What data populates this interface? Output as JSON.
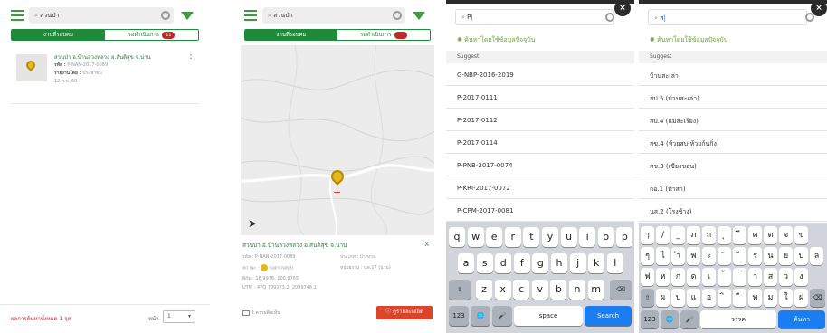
{
  "screens": {
    "list": {
      "search_value": "สวนป่า",
      "tab_map": "งานที่รอบคม",
      "tab_pending": "รอดำเนินการ",
      "pending_count": "11",
      "item": {
        "title": "สวนป่า อ.บ้านลวงหลวง อ.สันติสุข จ.น่าน",
        "code_label": "รหัส :",
        "code_value": "P-NAN-2017-0089",
        "name_label": "รายงานโดย :",
        "name_value": "ประชาชน",
        "meta": "12 ก.พ. 60"
      },
      "footer_left": "ผลการค้นหาทั้งหมด 1 จุด",
      "footer_page_label": "หน้า",
      "footer_page_value": "1"
    },
    "map": {
      "search_value": "สวนป่า",
      "tab_map": "งานที่รอบคม",
      "tab_pending": "รอดำเนินการ",
      "card": {
        "title": "สวนป่า อ.บ้านลวงหลวง อ.สันติสุข จ.น่าน",
        "close": "X",
        "row1_left": "รหัส : P-NAN-2017-0089",
        "row1_right": "ประเภท : ป่าสงวน",
        "row2_left": "สถานะ :",
        "row2_status": "รอตรวจสอบ",
        "row2_right": "หน่วยงาน : นพ.17 (น่าน)",
        "row3_left": "พิกัด : 18.9978, 100.9765",
        "row4_left": "UTM : 47Q 709273.2, 2099746.1",
        "link_left": "2 ความคิดเห็น",
        "detail_btn": "ดูรายละเอียด"
      }
    },
    "suggest_latin": {
      "search_value": "P",
      "hint": "ค้นหาโดยใช้ข้อมูลปัจจุบัน",
      "suggest_label": "Suggest",
      "items": [
        "G-NBP-2016-2019",
        "P-2017-0111",
        "P-2017-0112",
        "P-2017-0114",
        "P-PNB-2017-0074",
        "P-KRI-2017-0072",
        "P-CPM-2017-0081"
      ],
      "keyboard": {
        "row1": [
          "q",
          "w",
          "e",
          "r",
          "t",
          "y",
          "u",
          "i",
          "o",
          "p"
        ],
        "row2": [
          "a",
          "s",
          "d",
          "f",
          "g",
          "h",
          "j",
          "k",
          "l"
        ],
        "row3": [
          "z",
          "x",
          "c",
          "v",
          "b",
          "n",
          "m"
        ],
        "num": "123",
        "space": "space",
        "search": "Search"
      }
    },
    "suggest_thai": {
      "search_value": "ส",
      "hint": "ค้นหาโดยใช้ข้อมูลปัจจุบัน",
      "suggest_label": "Suggest",
      "items": [
        "บ้านสะเล่า",
        "สป.5 (บ้านสะเล่า)",
        "สป.4 (แม่สะเรียง)",
        "สข.4 (ห้วยสบ-ห้วยก้นกิ่ง)",
        "สช.3 (เขียงขอน)",
        "กอ.1 (ท่าสา)",
        "นส.2 (โรงช้าง)"
      ],
      "keyboard": {
        "row1": [
          "ๅ",
          "/",
          "_",
          "ภ",
          "ถ",
          "ุ",
          "ึ",
          "ค",
          "ต",
          "จ",
          "ข"
        ],
        "row2": [
          "ๆ",
          "ไ",
          "ำ",
          "พ",
          "ะ",
          "ั",
          "ี",
          "ร",
          "น",
          "ย",
          "บ",
          "ล"
        ],
        "row3": [
          "ฟ",
          "ห",
          "ก",
          "ด",
          "เ",
          "้",
          "่",
          "า",
          "ส",
          "ว",
          "ง"
        ],
        "row4": [
          "ผ",
          "ป",
          "แ",
          "อ",
          "ิ",
          "ื",
          "ท",
          "ม",
          "ใ",
          "ฝ"
        ],
        "num": "123",
        "space": "วรรค",
        "search": "ค้นหา"
      }
    }
  },
  "colors": {
    "green": "#1f8a3a",
    "red": "#c0282d",
    "blue_key": "#1a7df2",
    "keyboard_bg": "#d1d4da"
  }
}
